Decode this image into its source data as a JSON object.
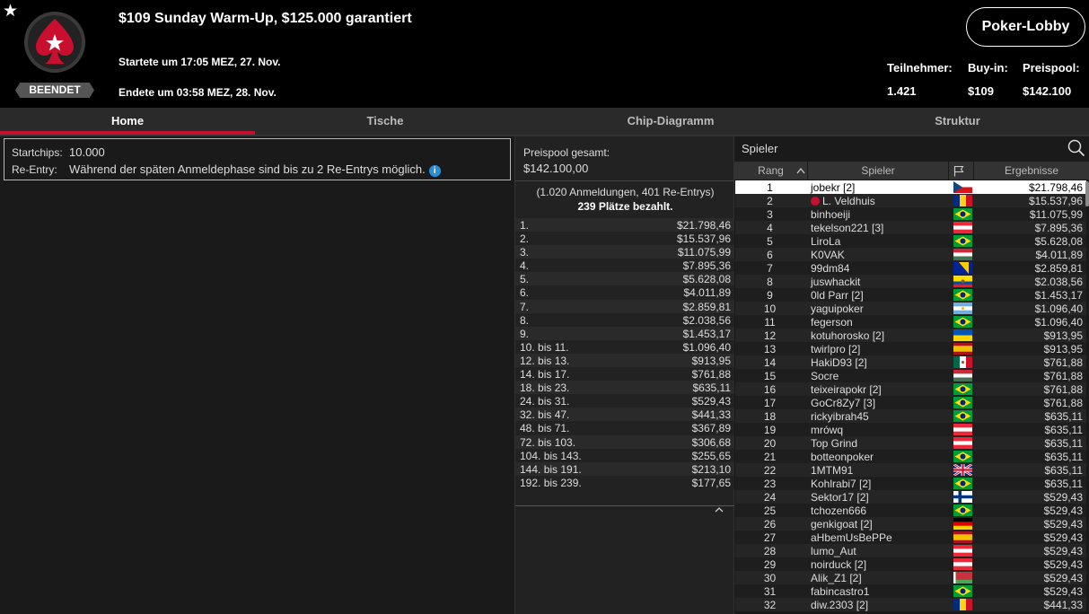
{
  "tournament": {
    "title": "$109 Sunday Warm-Up, $125.000 garantiert",
    "started": "Startete um 17:05 MEZ, 27. Nov.",
    "ended": "Endete um 03:58 MEZ, 28. Nov.",
    "status": "BEENDET",
    "lobby_button": "Poker-Lobby",
    "stats": [
      {
        "label": "Teilnehmer:",
        "value": "1.421"
      },
      {
        "label": "Buy-in:",
        "value": "$109"
      },
      {
        "label": "Preispool:",
        "value": "$142.100"
      }
    ]
  },
  "tabs": [
    "Home",
    "Tische",
    "Chip-Diagramm",
    "Struktur"
  ],
  "info": {
    "startchips_label": "Startchips:",
    "startchips_value": "10.000",
    "reentry_label": "Re-Entry:",
    "reentry_value": "Während der späten Anmeldephase sind bis zu 2 Re-Entrys möglich."
  },
  "prizes": {
    "pool_label": "Preispool gesamt:",
    "pool_value": "$142.100,00",
    "entries": "(1.020 Anmeldungen, 401 Re-Entrys)",
    "paid": "239 Plätze bezahlt.",
    "payouts": [
      {
        "place": "1.",
        "amount": "$21.798,46"
      },
      {
        "place": "2.",
        "amount": "$15.537,96"
      },
      {
        "place": "3.",
        "amount": "$11.075,99"
      },
      {
        "place": "4.",
        "amount": "$7.895,36"
      },
      {
        "place": "5.",
        "amount": "$5.628,08"
      },
      {
        "place": "6.",
        "amount": "$4.011,89"
      },
      {
        "place": "7.",
        "amount": "$2.859,81"
      },
      {
        "place": "8.",
        "amount": "$2.038,56"
      },
      {
        "place": "9.",
        "amount": "$1.453,17"
      },
      {
        "place": "10. bis 11.",
        "amount": "$1.096,40"
      },
      {
        "place": "12. bis 13.",
        "amount": "$913,95"
      },
      {
        "place": "14. bis 17.",
        "amount": "$761,88"
      },
      {
        "place": "18. bis 23.",
        "amount": "$635,11"
      },
      {
        "place": "24. bis 31.",
        "amount": "$529,43"
      },
      {
        "place": "32. bis 47.",
        "amount": "$441,33"
      },
      {
        "place": "48. bis 71.",
        "amount": "$367,89"
      },
      {
        "place": "72. bis 103.",
        "amount": "$306,68"
      },
      {
        "place": "104. bis 143.",
        "amount": "$255,65"
      },
      {
        "place": "144. bis 191.",
        "amount": "$213,10"
      },
      {
        "place": "192. bis 239.",
        "amount": "$177,65"
      }
    ]
  },
  "players": {
    "search_placeholder": "Spieler",
    "headers": {
      "rank": "Rang",
      "player": "Spieler",
      "results": "Ergebnisse"
    },
    "rows": [
      {
        "rank": "1",
        "name": "jobekr [2]",
        "flag": "cz",
        "amount": "$21.798,46"
      },
      {
        "rank": "2",
        "name": "L. Veldhuis",
        "flag": "ro",
        "amount": "$15.537,96",
        "pro": true
      },
      {
        "rank": "3",
        "name": "binhoeiji",
        "flag": "br",
        "amount": "$11.075,99"
      },
      {
        "rank": "4",
        "name": "tekelson221 [3]",
        "flag": "at",
        "amount": "$7.895,36"
      },
      {
        "rank": "5",
        "name": "LiroLa",
        "flag": "br",
        "amount": "$5.628,08"
      },
      {
        "rank": "6",
        "name": "K0VAK",
        "flag": "hu",
        "amount": "$4.011,89"
      },
      {
        "rank": "7",
        "name": "99dm84",
        "flag": "ba",
        "amount": "$2.859,81"
      },
      {
        "rank": "8",
        "name": "juswhackit",
        "flag": "ec",
        "amount": "$2.038,56"
      },
      {
        "rank": "9",
        "name": "0ld Parr [2]",
        "flag": "br",
        "amount": "$1.453,17"
      },
      {
        "rank": "10",
        "name": "yaguipoker",
        "flag": "ar",
        "amount": "$1.096,40"
      },
      {
        "rank": "11",
        "name": "fegerson",
        "flag": "br",
        "amount": "$1.096,40"
      },
      {
        "rank": "12",
        "name": "kotuhorosko [2]",
        "flag": "ua",
        "amount": "$913,95"
      },
      {
        "rank": "13",
        "name": "twirlpro [2]",
        "flag": "es",
        "amount": "$913,95"
      },
      {
        "rank": "14",
        "name": "HakiD93 [2]",
        "flag": "mx",
        "amount": "$761,88"
      },
      {
        "rank": "15",
        "name": "Socre",
        "flag": "hu",
        "amount": "$761,88"
      },
      {
        "rank": "16",
        "name": "teixeirapokr [2]",
        "flag": "br",
        "amount": "$761,88"
      },
      {
        "rank": "17",
        "name": "GoCr8Zy7 [3]",
        "flag": "br",
        "amount": "$761,88"
      },
      {
        "rank": "18",
        "name": "rickyibrah45",
        "flag": "br",
        "amount": "$635,11"
      },
      {
        "rank": "19",
        "name": "mrówq",
        "flag": "at",
        "amount": "$635,11"
      },
      {
        "rank": "20",
        "name": "Top Grind",
        "flag": "at",
        "amount": "$635,11"
      },
      {
        "rank": "21",
        "name": "botteonpoker",
        "flag": "br",
        "amount": "$635,11"
      },
      {
        "rank": "22",
        "name": "1MTM91",
        "flag": "gb",
        "amount": "$635,11"
      },
      {
        "rank": "23",
        "name": "Kohlrabi7 [2]",
        "flag": "br",
        "amount": "$635,11"
      },
      {
        "rank": "24",
        "name": "Sektor17 [2]",
        "flag": "fi",
        "amount": "$529,43"
      },
      {
        "rank": "25",
        "name": "tchozen666",
        "flag": "br",
        "amount": "$529,43"
      },
      {
        "rank": "26",
        "name": "genkigoat [2]",
        "flag": "de",
        "amount": "$529,43"
      },
      {
        "rank": "27",
        "name": "aHbemUsBePPe",
        "flag": "es",
        "amount": "$529,43"
      },
      {
        "rank": "28",
        "name": "lumo_Aut",
        "flag": "at",
        "amount": "$529,43"
      },
      {
        "rank": "29",
        "name": "noirduck [2]",
        "flag": "at",
        "amount": "$529,43"
      },
      {
        "rank": "30",
        "name": "Alik_Z1 [2]",
        "flag": "by",
        "amount": "$529,43"
      },
      {
        "rank": "31",
        "name": "fabincastro1",
        "flag": "br",
        "amount": "$529,43"
      },
      {
        "rank": "32",
        "name": "diw.2303 [2]",
        "flag": "ro",
        "amount": "$441,33"
      }
    ]
  },
  "colors": {
    "accent": "#c8102e",
    "background": "#1a1a1a",
    "header": "#000000"
  }
}
